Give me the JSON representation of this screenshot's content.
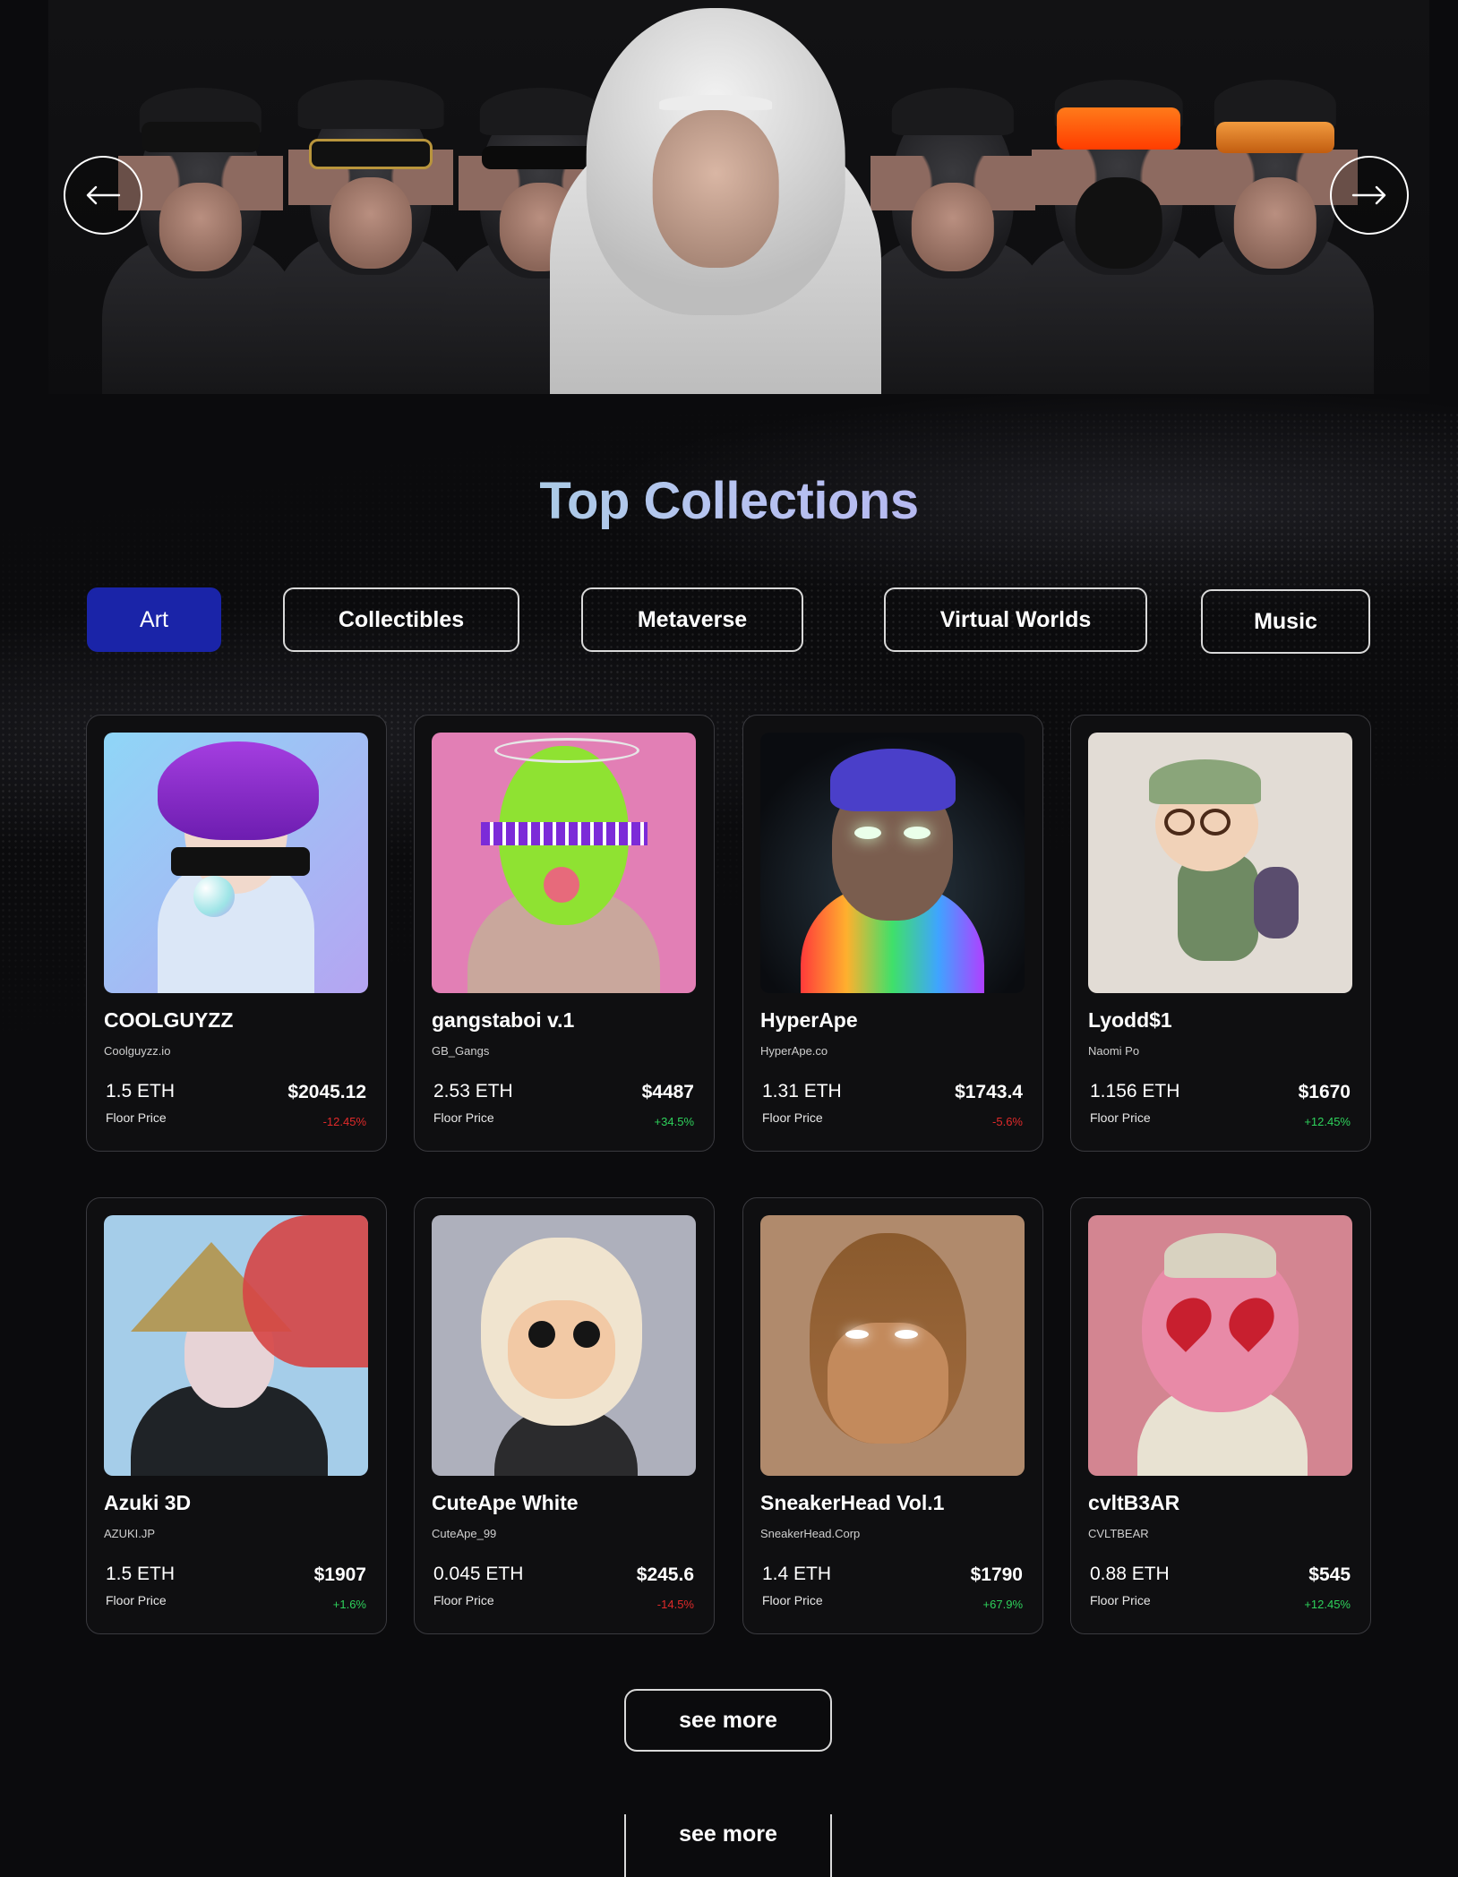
{
  "hero": {
    "prev_icon": "arrow-left-icon",
    "next_icon": "arrow-right-icon"
  },
  "section": {
    "title": "Top Collections"
  },
  "tabs": [
    {
      "label": "Art",
      "active": true
    },
    {
      "label": "Collectibles",
      "active": false
    },
    {
      "label": "Metaverse",
      "active": false
    },
    {
      "label": "Virtual Worlds",
      "active": false
    },
    {
      "label": "Music",
      "active": false
    }
  ],
  "cards": [
    {
      "name": "COOLGUYZZ",
      "handle": "Coolguyzz.io",
      "eth": "1.5 ETH",
      "floor_label": "Floor Price",
      "usd": "$2045.12",
      "change": "-12.45%",
      "trend": "down"
    },
    {
      "name": "gangstaboi v.1",
      "handle": "GB_Gangs",
      "eth": "2.53 ETH",
      "floor_label": "Floor Price",
      "usd": "$4487",
      "change": "+34.5%",
      "trend": "up"
    },
    {
      "name": "HyperApe",
      "handle": "HyperApe.co",
      "eth": "1.31 ETH",
      "floor_label": "Floor Price",
      "usd": "$1743.4",
      "change": "-5.6%",
      "trend": "down"
    },
    {
      "name": "Lyodd$1",
      "handle": "Naomi Po",
      "eth": "1.156 ETH",
      "floor_label": "Floor Price",
      "usd": "$1670",
      "change": "+12.45%",
      "trend": "up"
    },
    {
      "name": "Azuki 3D",
      "handle": "AZUKI.JP",
      "eth": "1.5 ETH",
      "floor_label": "Floor Price",
      "usd": "$1907",
      "change": "+1.6%",
      "trend": "up"
    },
    {
      "name": "CuteApe White",
      "handle": "CuteApe_99",
      "eth": "0.045 ETH",
      "floor_label": "Floor Price",
      "usd": "$245.6",
      "change": "-14.5%",
      "trend": "down"
    },
    {
      "name": "SneakerHead Vol.1",
      "handle": "SneakerHead.Corp",
      "eth": "1.4 ETH",
      "floor_label": "Floor Price",
      "usd": "$1790",
      "change": "+67.9%",
      "trend": "up"
    },
    {
      "name": "cvltB3AR",
      "handle": "CVLTBEAR",
      "eth": "0.88 ETH",
      "floor_label": "Floor Price",
      "usd": "$545",
      "change": "+12.45%",
      "trend": "up"
    }
  ],
  "footer": {
    "see_more_label": "see more",
    "see_more_label_2": "see more"
  },
  "colors": {
    "background": "#0b0b0d",
    "active_tab": "#1a24a8",
    "up": "#2ed15b",
    "down": "#e02a2a"
  }
}
